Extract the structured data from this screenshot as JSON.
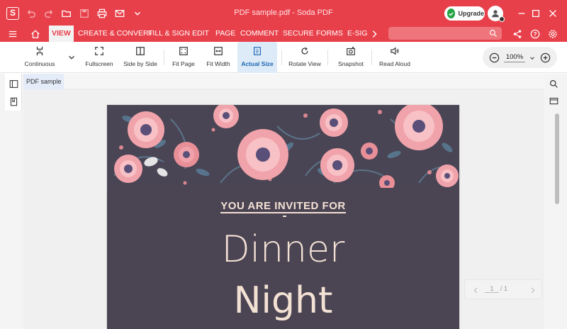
{
  "window": {
    "title": "PDF sample.pdf - Soda PDF",
    "app_logo_letter": "S",
    "upgrade_label": "Upgrade"
  },
  "menu": {
    "tabs": [
      "VIEW",
      "CREATE & CONVERT",
      "FILL & SIGN",
      "EDIT",
      "PAGE",
      "COMMENT",
      "SECURE",
      "FORMS",
      "E-SIGN"
    ],
    "active_tab": "VIEW"
  },
  "toolbar": {
    "tools": [
      {
        "label": "Continuous",
        "icon": "continuous-icon"
      },
      {
        "label": "Fullscreen",
        "icon": "fullscreen-icon"
      },
      {
        "label": "Side by Side",
        "icon": "side-by-side-icon"
      },
      {
        "label": "Fit Page",
        "icon": "fit-page-icon"
      },
      {
        "label": "Fit Width",
        "icon": "fit-width-icon"
      },
      {
        "label": "Actual Size",
        "icon": "actual-size-icon"
      },
      {
        "label": "Rotate View",
        "icon": "rotate-icon"
      },
      {
        "label": "Snapshot",
        "icon": "snapshot-icon"
      },
      {
        "label": "Read Aloud",
        "icon": "read-aloud-icon"
      }
    ],
    "active_tool": "Actual Size",
    "zoom": "100%"
  },
  "document": {
    "tab_name": "PDF sample",
    "invite_line": "YOU ARE INVITED FOR",
    "dash": "-",
    "headline_1": "Dinner",
    "headline_2": "Night"
  },
  "page_nav": {
    "current": "1",
    "total": "/ 1"
  },
  "colors": {
    "brand": "#e8404a",
    "page_bg": "#4b4453",
    "text_cream": "#f3e1d4",
    "active_tool_bg": "#ddeaf7"
  }
}
